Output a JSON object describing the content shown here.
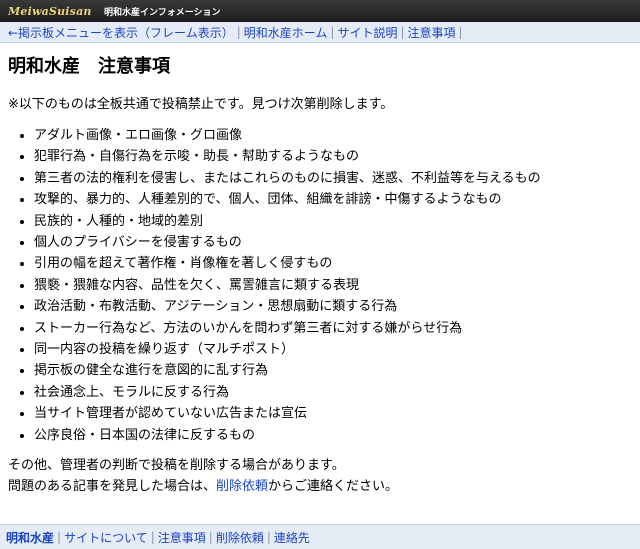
{
  "header": {
    "logo": "MeiwaSuisan",
    "title": "明和水産インフォメーション"
  },
  "nav": {
    "items": [
      {
        "label": "←掲示板メニューを表示（フレーム表示）"
      },
      {
        "label": "明和水産ホーム"
      },
      {
        "label": "サイト説明"
      },
      {
        "label": "注意事項"
      }
    ],
    "separator": "|"
  },
  "main": {
    "title": "明和水産　注意事項",
    "notice": "※以下のものは全板共通で投稿禁止です。見つけ次第削除します。",
    "rules": [
      "アダルト画像・エロ画像・グロ画像",
      "犯罪行為・自傷行為を示唆・助長・幇助するようなもの",
      "第三者の法的権利を侵害し、またはこれらのものに損害、迷惑、不利益等を与えるもの",
      "攻撃的、暴力的、人種差別的で、個人、団体、組織を誹謗・中傷するようなもの",
      "民族的・人種的・地域的差別",
      "個人のプライバシーを侵害するもの",
      "引用の幅を超えて著作権・肖像権を著しく侵すもの",
      "猥褻・猥雑な内容、品性を欠く、罵詈雑言に類する表現",
      "政治活動・布教活動、アジテーション・思想扇動に類する行為",
      "ストーカー行為など、方法のいかんを問わず第三者に対する嫌がらせ行為",
      "同一内容の投稿を繰り返す（マルチポスト）",
      "掲示板の健全な進行を意図的に乱す行為",
      "社会通念上、モラルに反する行為",
      "当サイト管理者が認めていない広告または宣伝",
      "公序良俗・日本国の法律に反するもの"
    ],
    "closing_line1": "その他、管理者の判断で投稿を削除する場合があります。",
    "closing_line2_prefix": "問題のある記事を発見した場合は、",
    "closing_link": "削除依頼",
    "closing_line2_suffix": "からご連絡ください。"
  },
  "footer": {
    "items": [
      {
        "label": "明和水産"
      },
      {
        "label": "サイトについて"
      },
      {
        "label": "注意事項"
      },
      {
        "label": "削除依頼"
      },
      {
        "label": "連絡先"
      }
    ],
    "separator": "|"
  },
  "colors": {
    "link": "#1a44c6",
    "navbar_bg": "#e6ecf6",
    "topbar_bg": "#2a2a2a",
    "logo": "#e8d27a"
  }
}
